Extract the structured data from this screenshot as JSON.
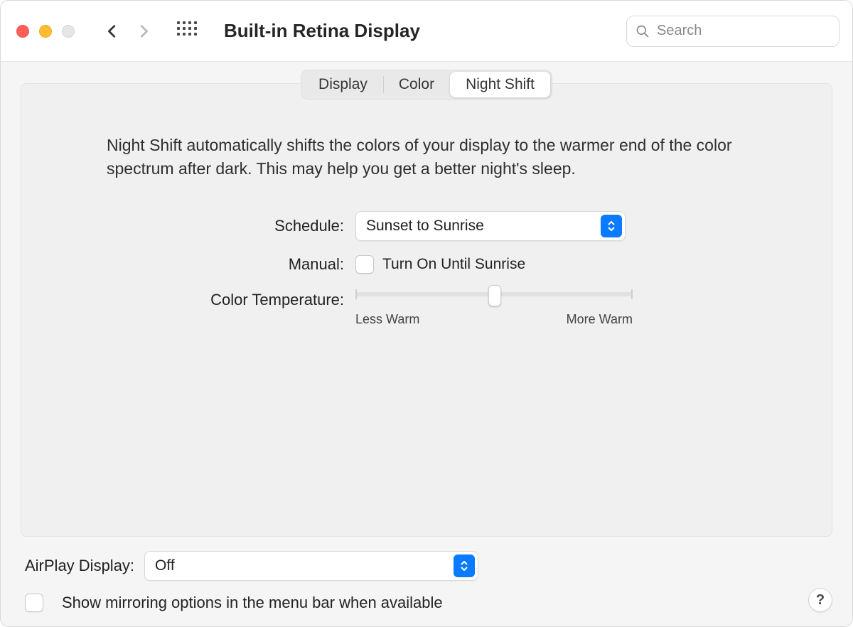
{
  "header": {
    "title": "Built-in Retina Display",
    "search_placeholder": "Search"
  },
  "tabs": {
    "items": [
      "Display",
      "Color",
      "Night Shift"
    ],
    "active_index": 2
  },
  "nightshift": {
    "description": "Night Shift automatically shifts the colors of your display to the warmer end of the color spectrum after dark. This may help you get a better night's sleep.",
    "schedule": {
      "label": "Schedule:",
      "value": "Sunset to Sunrise"
    },
    "manual": {
      "label": "Manual:",
      "checkbox_label": "Turn On Until Sunrise",
      "checked": false
    },
    "colortemp": {
      "label": "Color Temperature:",
      "minLabel": "Less Warm",
      "maxLabel": "More Warm",
      "value_percent": 48
    }
  },
  "airplay": {
    "label": "AirPlay Display:",
    "value": "Off"
  },
  "mirroring": {
    "label": "Show mirroring options in the menu bar when available",
    "checked": false
  },
  "help_label": "?"
}
